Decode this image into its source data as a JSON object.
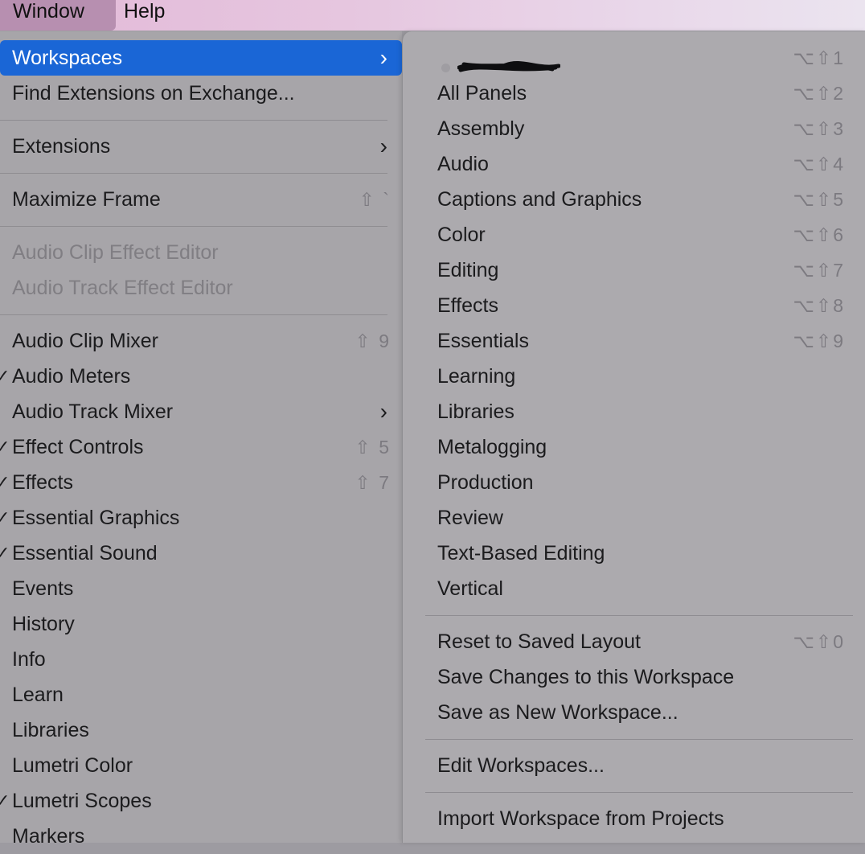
{
  "menubar": {
    "window": "Window",
    "help": "Help"
  },
  "window_menu": {
    "workspaces": "Workspaces",
    "find_extensions": "Find Extensions on Exchange...",
    "extensions": "Extensions",
    "maximize_frame": {
      "label": "Maximize Frame",
      "shortcut": "⇧ `"
    },
    "audio_clip_effect_editor": "Audio Clip Effect Editor",
    "audio_track_effect_editor": "Audio Track Effect Editor",
    "audio_clip_mixer": {
      "label": "Audio Clip Mixer",
      "shortcut": "⇧ 9"
    },
    "audio_meters": {
      "label": "Audio Meters",
      "checked": true
    },
    "audio_track_mixer": "Audio Track Mixer",
    "effect_controls": {
      "label": "Effect Controls",
      "shortcut": "⇧ 5",
      "checked": true
    },
    "effects": {
      "label": "Effects",
      "shortcut": "⇧ 7",
      "checked": true
    },
    "essential_graphics": {
      "label": "Essential Graphics",
      "checked": true
    },
    "essential_sound": {
      "label": "Essential Sound",
      "checked": true
    },
    "events": "Events",
    "history": "History",
    "info": "Info",
    "learn": "Learn",
    "libraries": "Libraries",
    "lumetri_color": "Lumetri Color",
    "lumetri_scopes": {
      "label": "Lumetri Scopes",
      "checked": true
    },
    "markers": "Markers",
    "check_glyph": "✓"
  },
  "workspaces_menu": {
    "redacted_shortcut": "⌥⇧1",
    "items": [
      {
        "label": "All Panels",
        "shortcut": "⌥⇧2"
      },
      {
        "label": "Assembly",
        "shortcut": "⌥⇧3"
      },
      {
        "label": "Audio",
        "shortcut": "⌥⇧4"
      },
      {
        "label": "Captions and Graphics",
        "shortcut": "⌥⇧5"
      },
      {
        "label": "Color",
        "shortcut": "⌥⇧6"
      },
      {
        "label": "Editing",
        "shortcut": "⌥⇧7"
      },
      {
        "label": "Effects",
        "shortcut": "⌥⇧8"
      },
      {
        "label": "Essentials",
        "shortcut": "⌥⇧9"
      },
      {
        "label": "Learning"
      },
      {
        "label": "Libraries"
      },
      {
        "label": "Metalogging"
      },
      {
        "label": "Production"
      },
      {
        "label": "Review"
      },
      {
        "label": "Text-Based Editing"
      },
      {
        "label": "Vertical"
      }
    ],
    "reset": {
      "label": "Reset to Saved Layout",
      "shortcut": "⌥⇧0"
    },
    "save_changes": "Save Changes to this Workspace",
    "save_new": "Save as New Workspace...",
    "edit": "Edit Workspaces...",
    "import": "Import Workspace from Projects"
  },
  "icons": {
    "submenu_arrow": "chevron-right-icon",
    "check": "checkmark-icon"
  },
  "colors": {
    "highlight": "#1a66d6",
    "menu_bg": "#a7a5a9",
    "disabled_text": "#807e83"
  }
}
